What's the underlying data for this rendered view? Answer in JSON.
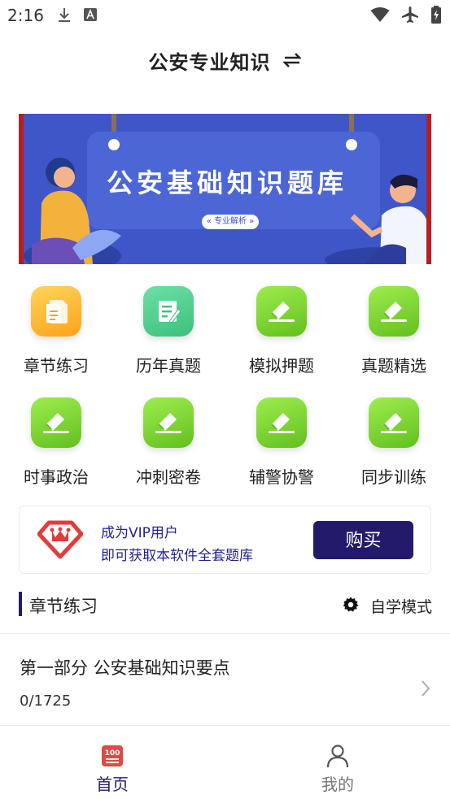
{
  "status_bar": {
    "time": "2:16"
  },
  "header": {
    "title": "公安专业知识"
  },
  "banner": {
    "title": "公安基础知识题库",
    "chip": "« 专业解析 »"
  },
  "grid": {
    "items": [
      {
        "label": "章节练习",
        "icon": "document-icon",
        "color": "#ffa21a"
      },
      {
        "label": "历年真题",
        "icon": "edit-note-icon",
        "color": "#3cc07a"
      },
      {
        "label": "模拟押题",
        "icon": "eraser-icon",
        "color": "#62c01e"
      },
      {
        "label": "真题精选",
        "icon": "eraser-icon",
        "color": "#62c01e"
      },
      {
        "label": "时事政治",
        "icon": "eraser-icon",
        "color": "#62c01e"
      },
      {
        "label": "冲刺密卷",
        "icon": "eraser-icon",
        "color": "#62c01e"
      },
      {
        "label": "辅警协警",
        "icon": "eraser-icon",
        "color": "#62c01e"
      },
      {
        "label": "同步训练",
        "icon": "eraser-icon",
        "color": "#62c01e"
      }
    ]
  },
  "vip": {
    "line1": "成为VIP用户",
    "line2": "即可获取本软件全套题库",
    "buy_label": "购买",
    "accent": "#231a6b"
  },
  "section": {
    "title": "章节练习",
    "mode_label": "自学模式"
  },
  "chapter": {
    "title": "第一部分 公安基础知识要点",
    "progress": "0/1725"
  },
  "bottom_nav": {
    "home_label": "首页",
    "home_badge": "100",
    "mine_label": "我的"
  }
}
